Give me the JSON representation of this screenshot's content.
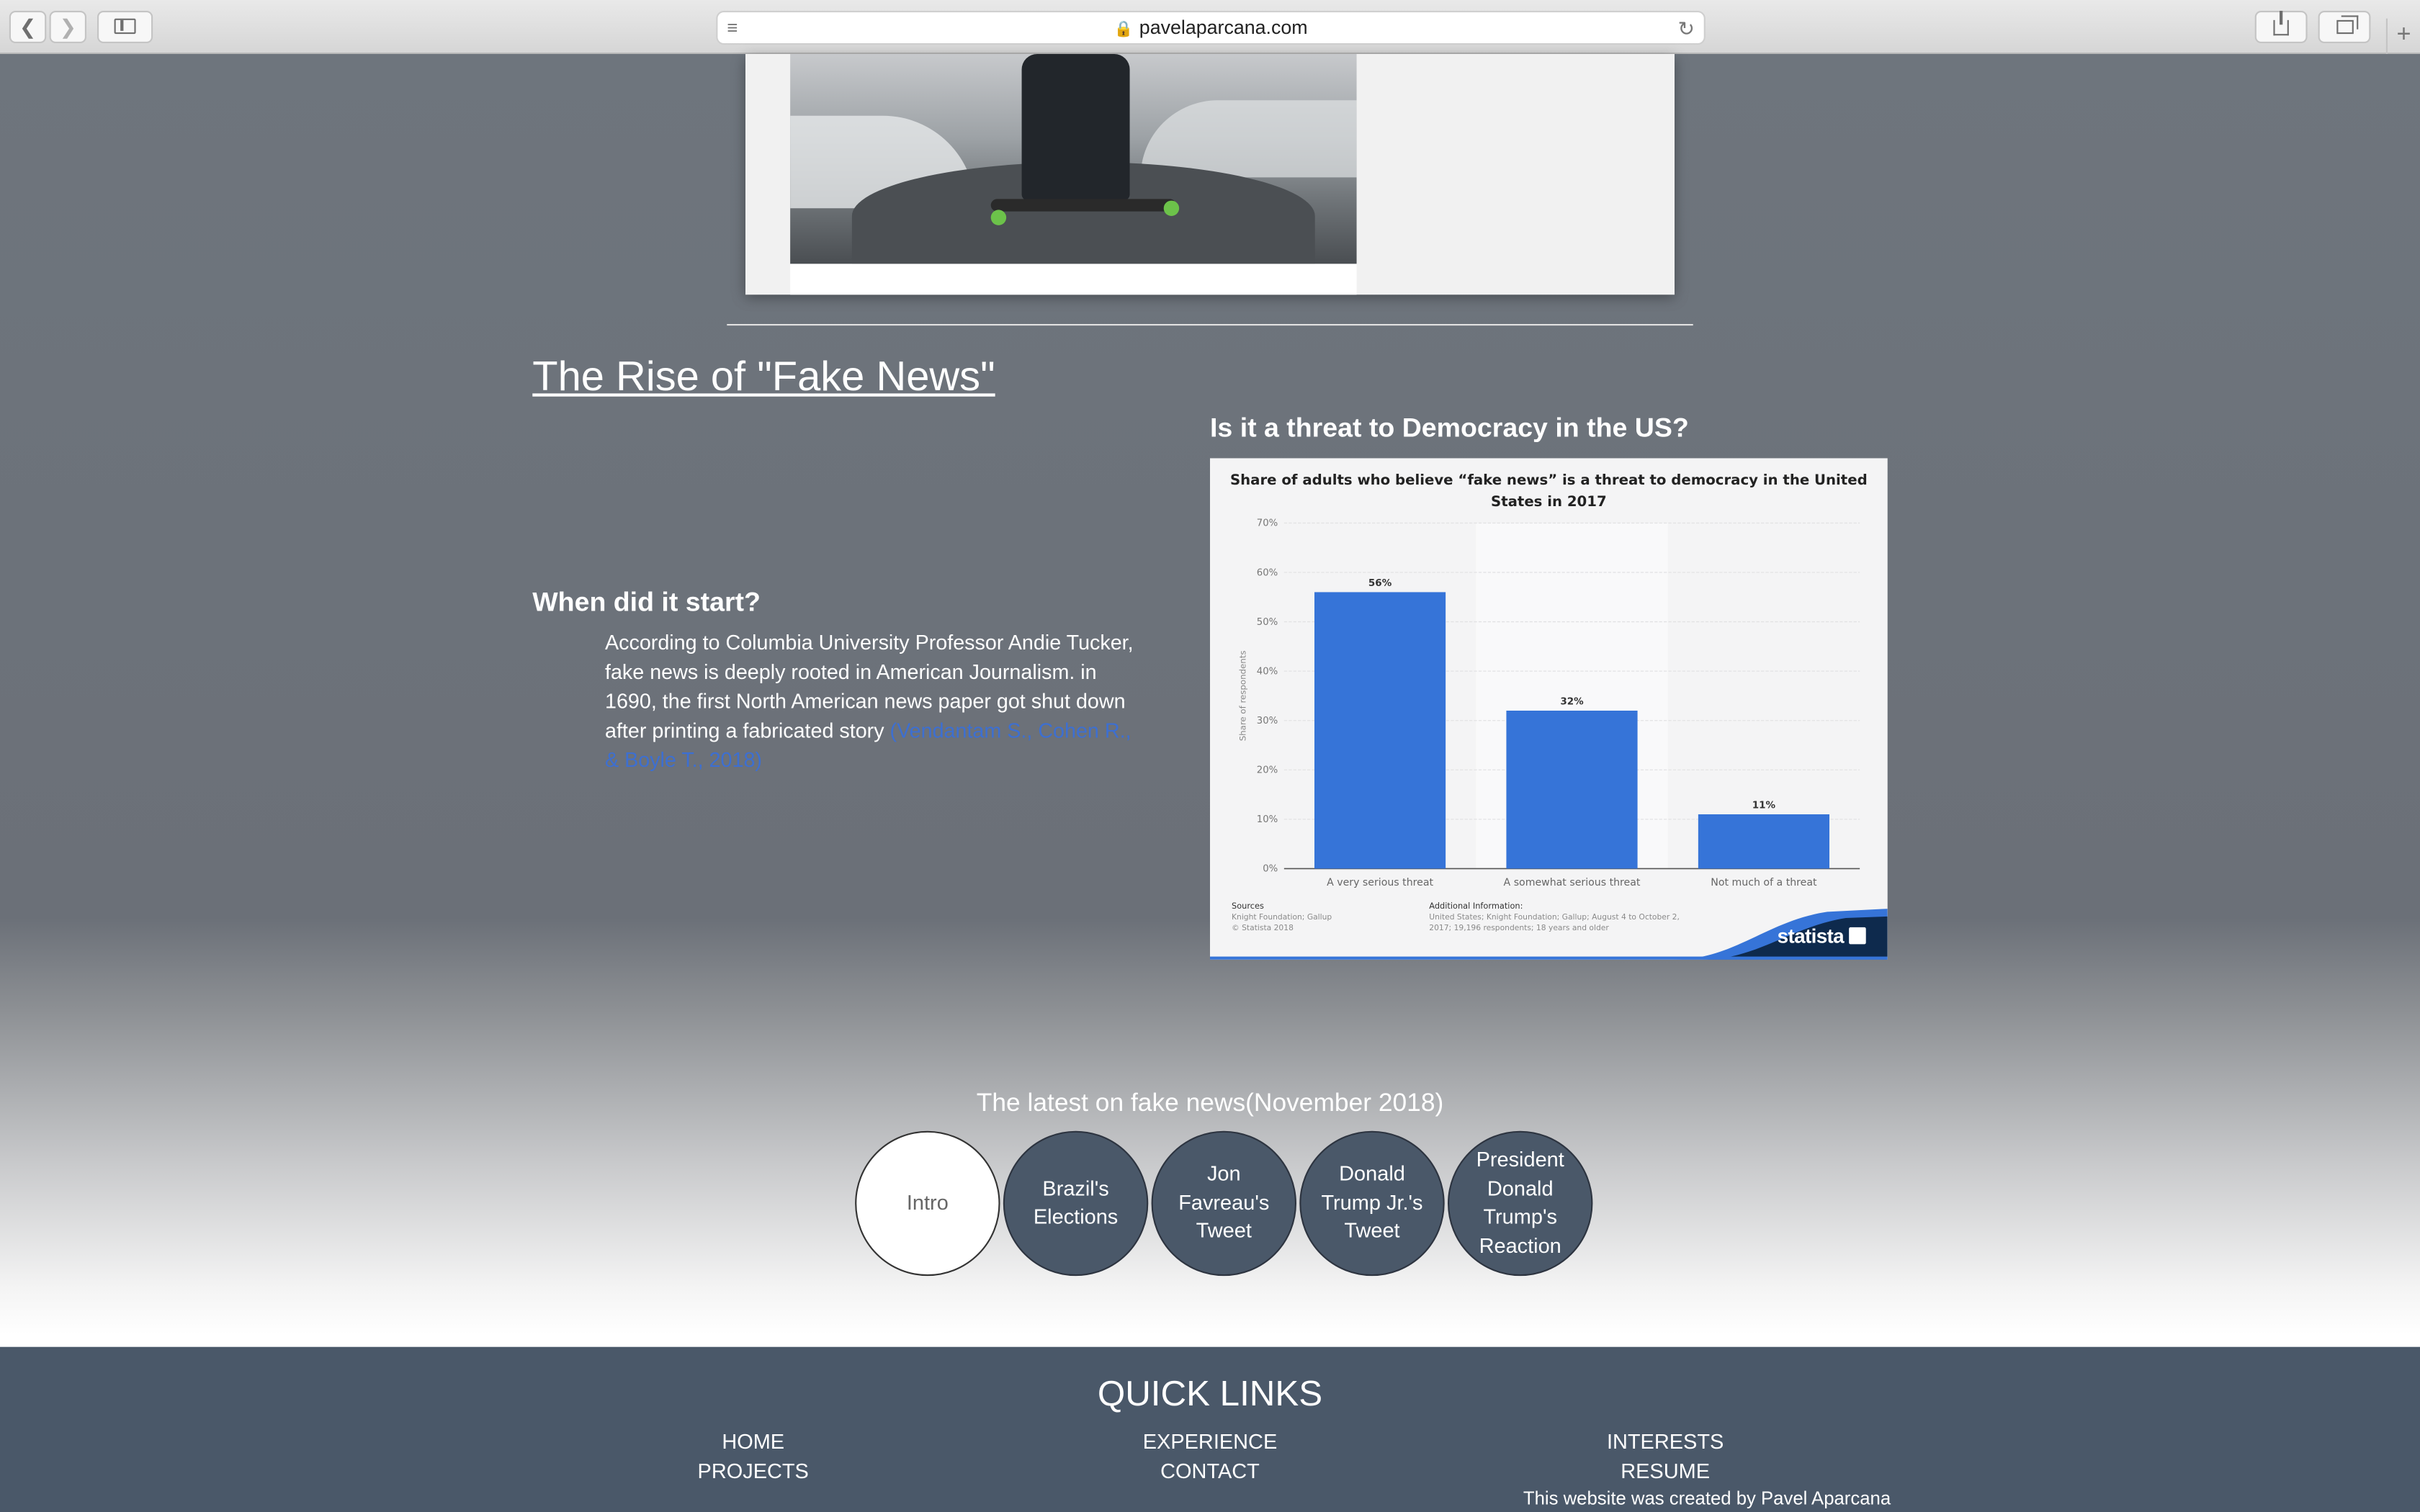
{
  "browser": {
    "url": "pavelaparcana.com",
    "back_icon": "chevron-left-icon",
    "forward_icon": "chevron-right-icon"
  },
  "article": {
    "title": "The Rise of \"Fake News\"",
    "chart_heading": "Is it a threat to Democracy in the US?",
    "when_heading": "When did it start?",
    "paragraph": "According to Columbia University Professor Andie Tucker, fake news is deeply rooted in American Journalism. in 1690, the first North American news paper got shut down after printing a fabricated story ",
    "citation": "(Vendantam S., Cohen R., & Boyle T., 2018)"
  },
  "chart_data": {
    "type": "bar",
    "title": "Share of adults who believe “fake news” is a threat to democracy in the United States in 2017",
    "ylabel": "Share of respondents",
    "xlabel": "",
    "categories": [
      "A very serious threat",
      "A somewhat serious threat",
      "Not much of a threat"
    ],
    "values": [
      56,
      32,
      11
    ],
    "data_labels": [
      "56%",
      "32%",
      "11%"
    ],
    "ylim": [
      0,
      70
    ],
    "yticks": [
      "0%",
      "10%",
      "20%",
      "30%",
      "40%",
      "50%",
      "60%",
      "70%"
    ],
    "grid": true,
    "bar_color": "#3674d8",
    "sources_label": "Sources",
    "sources_lines": [
      "Knight Foundation; Gallup",
      "© Statista 2018"
    ],
    "additional_label": "Additional Information:",
    "additional_lines": [
      "United States; Knight Foundation; Gallup; August 4 to October 2,",
      "2017; 19,196 respondents; 18 years and older"
    ],
    "brand": "statista"
  },
  "latest": {
    "title": "The latest on fake news(November 2018)",
    "bubbles": [
      "Intro",
      "Brazil's Elections",
      "Jon Favreau's Tweet",
      "Donald Trump Jr.'s Tweet",
      "President Donald Trump's Reaction"
    ]
  },
  "footer": {
    "title": "QUICK LINKS",
    "links": {
      "home": "HOME",
      "projects": "PROJECTS",
      "experience": "EXPERIENCE",
      "contact": "CONTACT",
      "interests": "INTERESTS",
      "resume": "RESUME"
    },
    "credit": "This website was created by Pavel Aparcana"
  },
  "colors": {
    "page_bg": "#6b7078",
    "footer_bg": "#4a5869",
    "link": "#3d6fd1",
    "chart_bar": "#3674d8"
  }
}
